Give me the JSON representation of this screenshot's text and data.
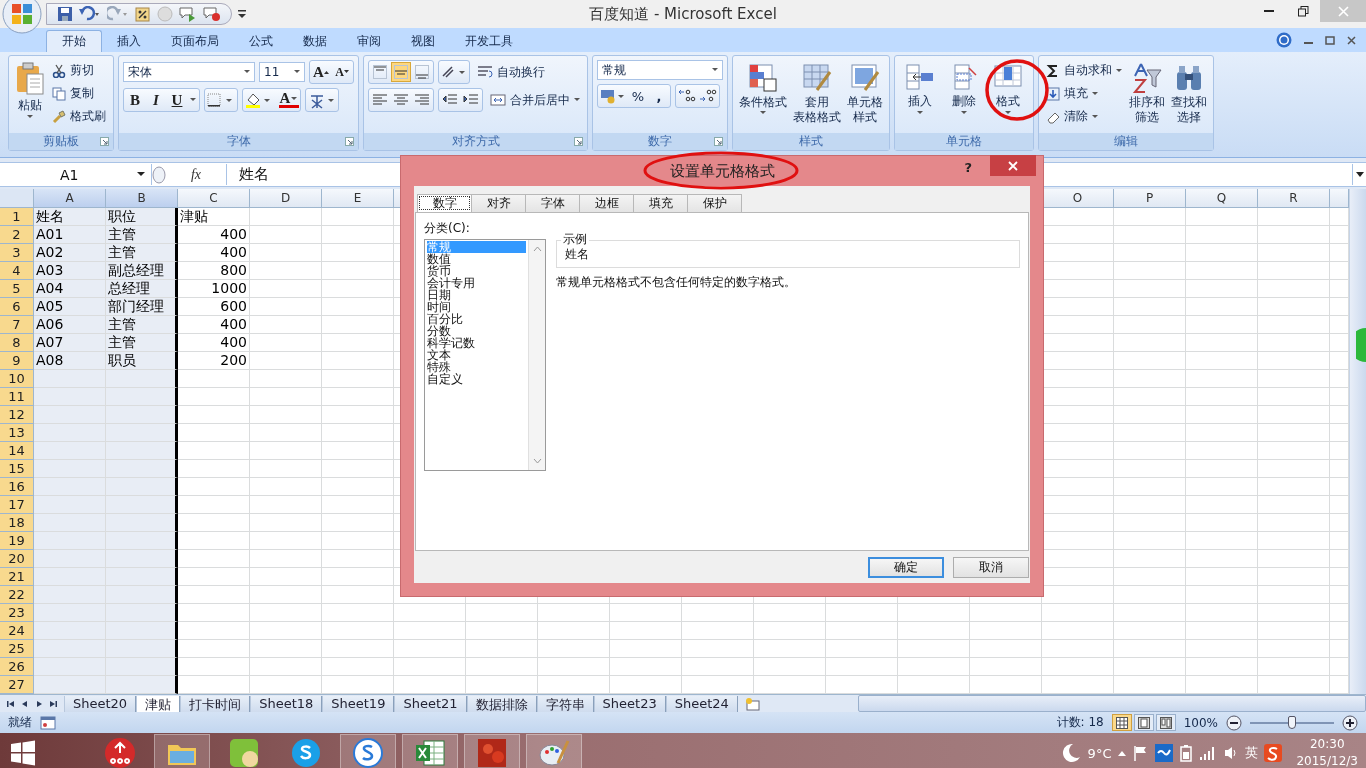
{
  "window": {
    "title": "百度知道 - Microsoft Excel"
  },
  "ribbon_tabs": [
    {
      "label": "开始",
      "selected": true
    },
    {
      "label": "插入",
      "selected": false
    },
    {
      "label": "页面布局",
      "selected": false
    },
    {
      "label": "公式",
      "selected": false
    },
    {
      "label": "数据",
      "selected": false
    },
    {
      "label": "审阅",
      "selected": false
    },
    {
      "label": "视图",
      "selected": false
    },
    {
      "label": "开发工具",
      "selected": false
    }
  ],
  "clipboard": {
    "label": "剪贴板",
    "paste": "粘贴",
    "items": [
      {
        "kind": "cut",
        "label": "剪切"
      },
      {
        "kind": "copy",
        "label": "复制"
      },
      {
        "kind": "painter",
        "label": "格式刷"
      }
    ]
  },
  "font": {
    "label": "字体",
    "name": "宋体",
    "size": "11",
    "grow": "A",
    "shrink": "A",
    "bold": "B",
    "italic": "I",
    "underline": "U",
    "font_color": "A"
  },
  "alignment": {
    "label": "对齐方式",
    "vertical": [
      {
        "kind": "top",
        "selected": false
      },
      {
        "kind": "middle",
        "selected": true
      },
      {
        "kind": "bottom",
        "selected": false
      }
    ],
    "wrap": "自动换行",
    "merge": "合并后居中"
  },
  "number": {
    "label": "数字",
    "format": "常规",
    "percent": "%",
    "comma": ","
  },
  "styles": {
    "label": "样式",
    "buttons": [
      {
        "kind": "conditional",
        "lines": [
          "条件格式"
        ]
      },
      {
        "kind": "table",
        "lines": [
          "套用",
          "表格格式"
        ]
      },
      {
        "kind": "cellstyle",
        "lines": [
          "单元格",
          "样式"
        ]
      }
    ]
  },
  "cells": {
    "label": "单元格",
    "buttons": [
      {
        "kind": "insert",
        "label": "插入"
      },
      {
        "kind": "delete",
        "label": "删除"
      },
      {
        "kind": "format",
        "label": "格式"
      }
    ]
  },
  "editing": {
    "label": "编辑",
    "items": [
      {
        "kind": "sum",
        "label": "自动求和"
      },
      {
        "kind": "fill",
        "label": "填充"
      },
      {
        "kind": "clear",
        "label": "清除"
      }
    ],
    "buttons": [
      {
        "kind": "sort",
        "lines": [
          "排序和",
          "筛选"
        ]
      },
      {
        "kind": "find",
        "lines": [
          "查找和",
          "选择"
        ]
      }
    ]
  },
  "formula_bar": {
    "name_box": "A1",
    "fx": "fx",
    "value": "姓名"
  },
  "columns": [
    {
      "label": "A",
      "selected": true
    },
    {
      "label": "B",
      "selected": true
    },
    {
      "label": "C",
      "selected": false
    },
    {
      "label": "D",
      "selected": false
    },
    {
      "label": "E",
      "selected": false
    },
    {
      "label": "O",
      "selected": false
    },
    {
      "label": "P",
      "selected": false
    },
    {
      "label": "Q",
      "selected": false
    },
    {
      "label": "R",
      "selected": false
    }
  ],
  "rows": [
    {
      "number": "1",
      "selected": true,
      "cells": [
        "姓名",
        "职位",
        "津贴"
      ]
    },
    {
      "number": "2",
      "selected": true,
      "cells": [
        "A01",
        "主管",
        "400"
      ]
    },
    {
      "number": "3",
      "selected": true,
      "cells": [
        "A02",
        "主管",
        "400"
      ]
    },
    {
      "number": "4",
      "selected": true,
      "cells": [
        "A03",
        "副总经理",
        "800"
      ]
    },
    {
      "number": "5",
      "selected": true,
      "cells": [
        "A04",
        "总经理",
        "1000"
      ]
    },
    {
      "number": "6",
      "selected": true,
      "cells": [
        "A05",
        "部门经理",
        "600"
      ]
    },
    {
      "number": "7",
      "selected": true,
      "cells": [
        "A06",
        "主管",
        "400"
      ]
    },
    {
      "number": "8",
      "selected": true,
      "cells": [
        "A07",
        "主管",
        "400"
      ]
    },
    {
      "number": "9",
      "selected": true,
      "cells": [
        "A08",
        "职员",
        "200"
      ]
    },
    {
      "number": "10",
      "selected": true
    },
    {
      "number": "11",
      "selected": true
    },
    {
      "number": "12",
      "selected": true
    },
    {
      "number": "13",
      "selected": true
    },
    {
      "number": "14",
      "selected": true
    },
    {
      "number": "15",
      "selected": true
    },
    {
      "number": "16",
      "selected": true
    },
    {
      "number": "17",
      "selected": true
    },
    {
      "number": "18",
      "selected": true
    },
    {
      "number": "19",
      "selected": true
    },
    {
      "number": "20",
      "selected": true
    },
    {
      "number": "21",
      "selected": true
    },
    {
      "number": "22",
      "selected": true
    },
    {
      "number": "23",
      "selected": true
    },
    {
      "number": "24",
      "selected": true
    },
    {
      "number": "25",
      "selected": true
    },
    {
      "number": "26",
      "selected": true
    },
    {
      "number": "27",
      "selected": true
    }
  ],
  "sheet_tabs": [
    {
      "label": "Sheet20",
      "selected": false
    },
    {
      "label": "津贴",
      "selected": true
    },
    {
      "label": "打卡时间",
      "selected": false
    },
    {
      "label": "Sheet18",
      "selected": false
    },
    {
      "label": "Sheet19",
      "selected": false
    },
    {
      "label": "Sheet21",
      "selected": false
    },
    {
      "label": "数据排除",
      "selected": false
    },
    {
      "label": "字符串",
      "selected": false
    },
    {
      "label": "Sheet23",
      "selected": false
    },
    {
      "label": "Sheet24",
      "selected": false
    }
  ],
  "status": {
    "ready": "就绪",
    "count": "计数: 18",
    "views": [
      {
        "kind": "normal",
        "selected": true
      },
      {
        "kind": "layout",
        "selected": false
      },
      {
        "kind": "break",
        "selected": false
      }
    ],
    "zoom": "100%",
    "zoom_slider": {
      "level": 0.5
    }
  },
  "dialog": {
    "title": "设置单元格格式",
    "help": "?",
    "tabs": [
      {
        "label": "数字",
        "selected": true
      },
      {
        "label": "对齐",
        "selected": false
      },
      {
        "label": "字体",
        "selected": false
      },
      {
        "label": "边框",
        "selected": false
      },
      {
        "label": "填充",
        "selected": false
      },
      {
        "label": "保护",
        "selected": false
      }
    ],
    "category_label": "分类(C):",
    "categories": [
      {
        "label": "常规",
        "selected": true
      },
      {
        "label": "数值",
        "selected": false
      },
      {
        "label": "货币",
        "selected": false
      },
      {
        "label": "会计专用",
        "selected": false
      },
      {
        "label": "日期",
        "selected": false
      },
      {
        "label": "时间",
        "selected": false
      },
      {
        "label": "百分比",
        "selected": false
      },
      {
        "label": "分数",
        "selected": false
      },
      {
        "label": "科学记数",
        "selected": false
      },
      {
        "label": "文本",
        "selected": false
      },
      {
        "label": "特殊",
        "selected": false
      },
      {
        "label": "自定义",
        "selected": false
      }
    ],
    "sample_label": "示例",
    "sample_value": "姓名",
    "description": "常规单元格格式不包含任何特定的数字格式。",
    "buttons": [
      {
        "label": "确定",
        "default": true
      },
      {
        "label": "取消",
        "default": false
      }
    ]
  },
  "taskbar": {
    "apps": [
      {
        "kind": "network",
        "running": false
      },
      {
        "kind": "folder",
        "running": true
      },
      {
        "kind": "video",
        "running": false
      },
      {
        "kind": "skype",
        "running": false
      },
      {
        "kind": "browser",
        "running": true
      },
      {
        "kind": "excel",
        "running": true
      },
      {
        "kind": "photo",
        "running": true
      },
      {
        "kind": "paint",
        "running": true
      }
    ],
    "temperature": "9°C",
    "ime": "英",
    "time": "20:30",
    "date": "2015/12/3"
  }
}
